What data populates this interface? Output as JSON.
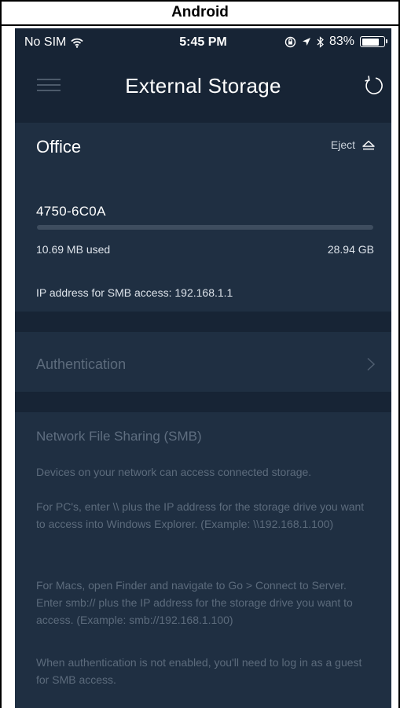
{
  "document": {
    "caption": "Android"
  },
  "status_bar": {
    "carrier": "No SIM",
    "time": "5:45 PM",
    "battery": "83%",
    "battery_level": 0.83
  },
  "header": {
    "title": "External Storage"
  },
  "storage": {
    "location": "Office",
    "eject_label": "Eject",
    "drive_name": "4750-6C0A",
    "used": "10.69 MB used",
    "capacity": "28.94 GB",
    "usage_fraction": 0.0,
    "ip": "IP address for SMB access: 192.168.1.1"
  },
  "authentication": {
    "label": "Authentication"
  },
  "smb": {
    "title": "Network File Sharing (SMB)",
    "paragraphs": [
      "Devices on your network can access connected storage.",
      "For PC's, enter \\\\ plus the IP address for the storage drive you want to access into Windows Explorer. (Example: \\\\192.168.1.100)",
      "For Macs, open Finder and navigate to Go > Connect to Server. Enter smb:// plus the IP address for the storage drive you want to access. (Example: smb://192.168.1.100)",
      "When authentication is not enabled, you'll need to log in as a guest for SMB access."
    ]
  },
  "colors": {
    "background": "#172435",
    "card": "#1f2f42",
    "muted_text": "#5c6b7c"
  }
}
